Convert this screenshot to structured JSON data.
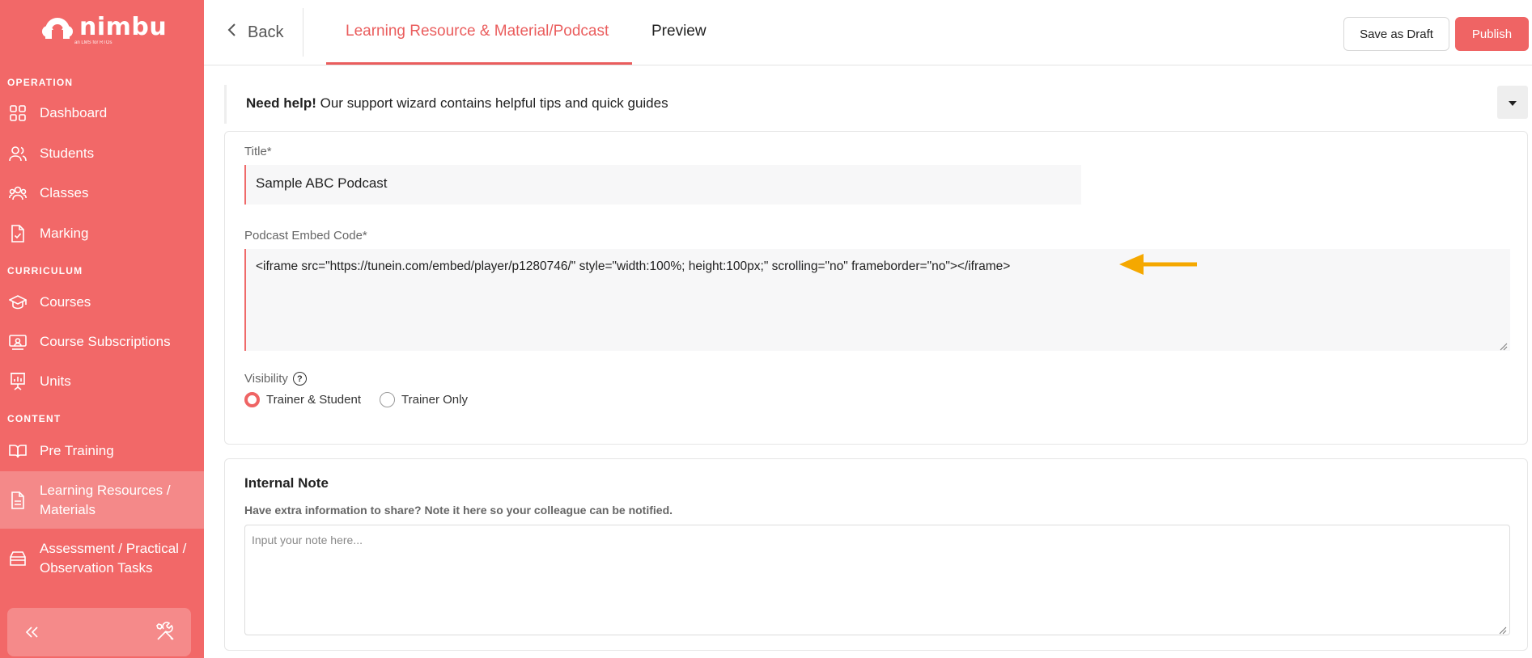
{
  "brand": {
    "name": "nimbu",
    "tagline": "an LMS for RTOs",
    "accent": "#f26868"
  },
  "sidebar": {
    "sections": [
      {
        "label": "OPERATION"
      },
      {
        "label": "CURRICULUM"
      },
      {
        "label": "CONTENT"
      }
    ],
    "items": [
      {
        "label": "Dashboard",
        "icon": "grid-icon"
      },
      {
        "label": "Students",
        "icon": "users-icon"
      },
      {
        "label": "Classes",
        "icon": "group-icon"
      },
      {
        "label": "Marking",
        "icon": "document-check-icon"
      },
      {
        "label": "Courses",
        "icon": "graduation-cap-icon"
      },
      {
        "label": "Course Subscriptions",
        "icon": "presentation-icon"
      },
      {
        "label": "Units",
        "icon": "chart-board-icon"
      },
      {
        "label": "Pre Training",
        "icon": "book-open-icon"
      },
      {
        "label": "Learning Resources / Materials",
        "icon": "file-text-icon",
        "active": true
      },
      {
        "label": "Assessment / Practical / Observation Tasks",
        "icon": "archive-icon"
      }
    ],
    "collapse_icon": "double-chevron-left-icon",
    "tools_icon": "tools-icon"
  },
  "topbar": {
    "back_label": "Back",
    "tabs": [
      {
        "label": "Learning Resource & Material/Podcast",
        "active": true
      },
      {
        "label": "Preview",
        "active": false
      }
    ],
    "save_draft_label": "Save as Draft",
    "publish_label": "Publish"
  },
  "help": {
    "bold": "Need help!",
    "text": " Our support wizard contains helpful tips and quick guides"
  },
  "form": {
    "title_label": "Title*",
    "title_value": "Sample ABC Podcast",
    "embed_label": "Podcast Embed Code*",
    "embed_value": "<iframe src=\"https://tunein.com/embed/player/p1280746/\" style=\"width:100%; height:100px;\" scrolling=\"no\" frameborder=\"no\"></iframe>",
    "visibility_label": "Visibility",
    "visibility_options": [
      {
        "label": "Trainer & Student",
        "checked": true
      },
      {
        "label": "Trainer Only",
        "checked": false
      }
    ]
  },
  "note": {
    "title": "Internal Note",
    "subtitle": "Have extra information to share? Note it here so your colleague can be notified.",
    "placeholder": "Input your note here..."
  },
  "annotation": {
    "arrow_color": "#f5a800"
  }
}
